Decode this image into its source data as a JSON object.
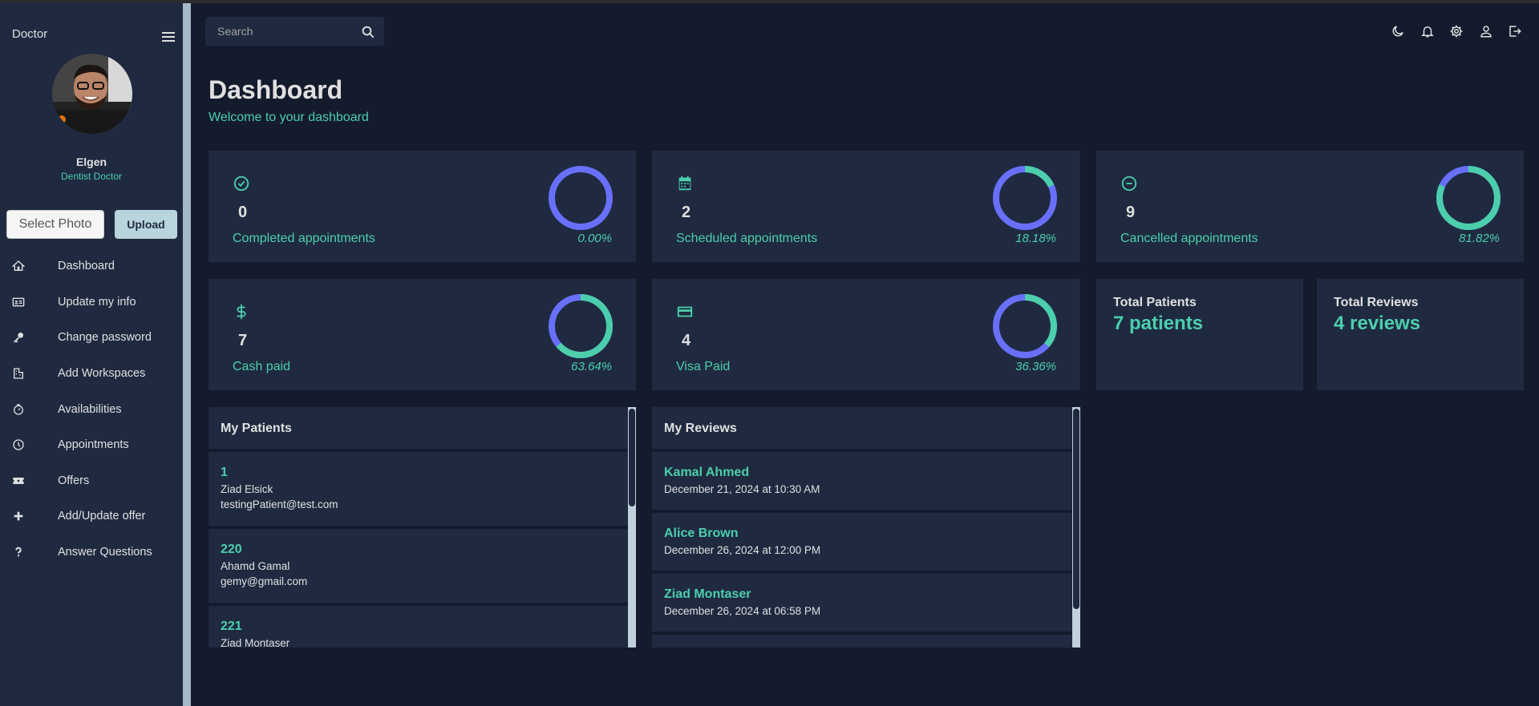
{
  "sidebar": {
    "role": "Doctor",
    "user_name": "Elgen",
    "user_title": "Dentist Doctor",
    "select_photo_label": "Select Photo",
    "upload_label": "Upload",
    "items": [
      {
        "label": "Dashboard",
        "icon": "home-icon"
      },
      {
        "label": "Update my info",
        "icon": "id-card-icon"
      },
      {
        "label": "Change password",
        "icon": "key-icon"
      },
      {
        "label": "Add Workspaces",
        "icon": "building-icon"
      },
      {
        "label": "Availabilities",
        "icon": "timer-icon"
      },
      {
        "label": "Appointments",
        "icon": "clock-icon"
      },
      {
        "label": "Offers",
        "icon": "ticket-icon"
      },
      {
        "label": "Add/Update offer",
        "icon": "plus-icon"
      },
      {
        "label": "Answer Questions",
        "icon": "question-icon"
      }
    ]
  },
  "topbar": {
    "search_placeholder": "Search",
    "icons": [
      "moon-icon",
      "bell-icon",
      "gear-icon",
      "person-icon",
      "logout-icon"
    ]
  },
  "header": {
    "title": "Dashboard",
    "subtitle": "Welcome to your dashboard"
  },
  "stats": {
    "completed": {
      "value": "0",
      "label": "Completed appointments",
      "percent": "0.00%",
      "fraction": 0.0,
      "icon": "check-circle-icon"
    },
    "scheduled": {
      "value": "2",
      "label": "Scheduled appointments",
      "percent": "18.18%",
      "fraction": 0.1818,
      "icon": "calendar-icon"
    },
    "cancelled": {
      "value": "9",
      "label": "Cancelled appointments",
      "percent": "81.82%",
      "fraction": 0.8182,
      "icon": "minus-circle-icon"
    },
    "cash": {
      "value": "7",
      "label": "Cash paid",
      "percent": "63.64%",
      "fraction": 0.6364,
      "icon": "dollar-icon"
    },
    "visa": {
      "value": "4",
      "label": "Visa Paid",
      "percent": "36.36%",
      "fraction": 0.3636,
      "icon": "credit-card-icon"
    }
  },
  "totals": {
    "patients": {
      "title": "Total Patients",
      "value": "7 patients"
    },
    "reviews": {
      "title": "Total Reviews",
      "value": "4 reviews"
    }
  },
  "patients": {
    "title": "My Patients",
    "items": [
      {
        "id": "1",
        "name": "Ziad Elsick",
        "email": "testingPatient@test.com"
      },
      {
        "id": "220",
        "name": "Ahamd Gamal",
        "email": "gemy@gmail.com"
      },
      {
        "id": "221",
        "name": "Ziad Montaser",
        "email": ""
      }
    ]
  },
  "reviews": {
    "title": "My Reviews",
    "items": [
      {
        "name": "Kamal Ahmed",
        "date": "December 21, 2024 at 10:30 AM"
      },
      {
        "name": "Alice Brown",
        "date": "December 26, 2024 at 12:00 PM"
      },
      {
        "name": "Ziad Montaser",
        "date": "December 26, 2024 at 06:58 PM"
      }
    ]
  },
  "colors": {
    "accent": "#4cceac",
    "ring_fill": "#4cceac",
    "ring_track": "#6870fa",
    "card_bg": "#1f2a40",
    "page_bg": "#141b2d"
  }
}
